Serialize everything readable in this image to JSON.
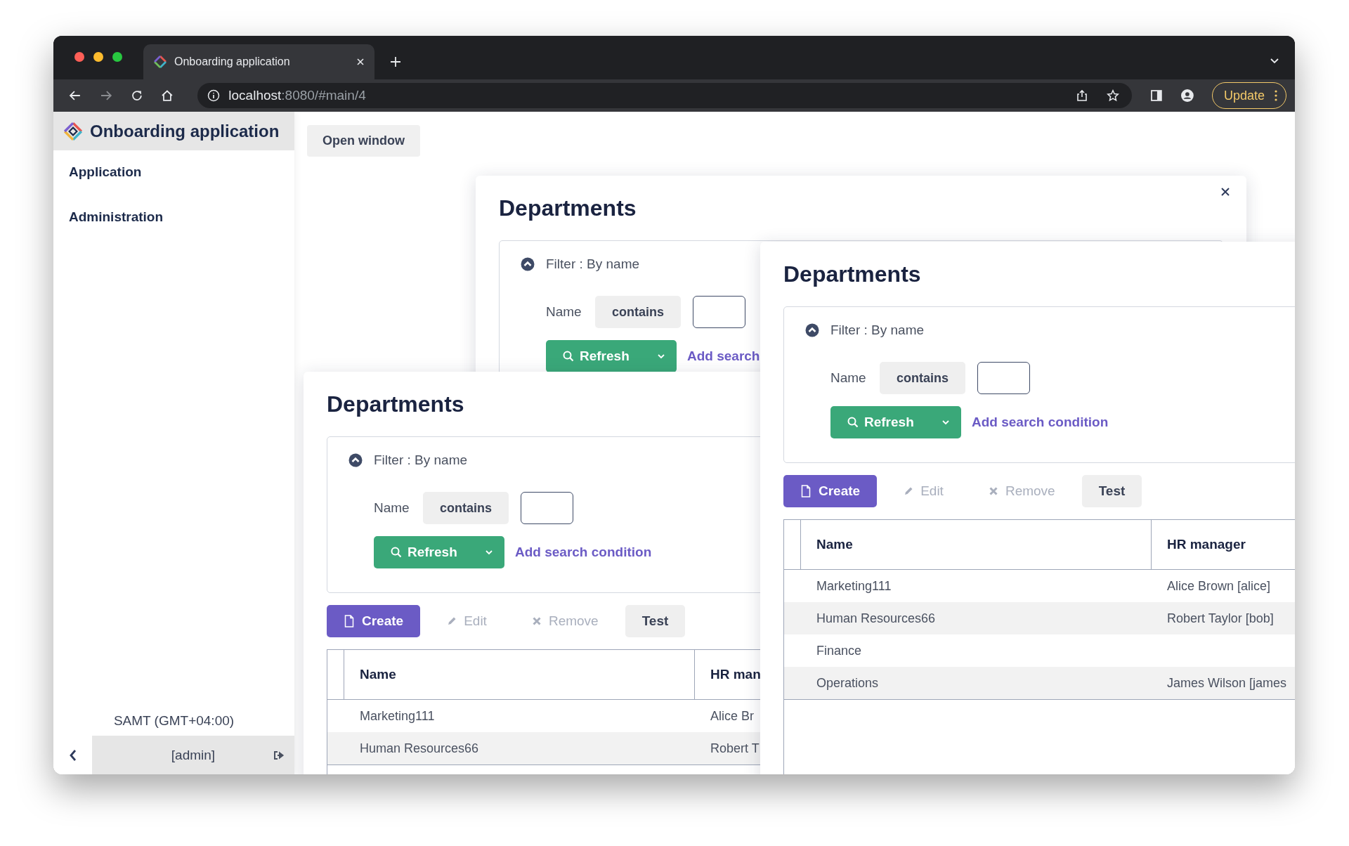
{
  "browser": {
    "tab_title": "Onboarding application",
    "url_host": "localhost",
    "url_path": ":8080/#main/4",
    "update_label": "Update"
  },
  "sidebar": {
    "title": "Onboarding application",
    "items": [
      {
        "label": "Application"
      },
      {
        "label": "Administration"
      }
    ],
    "timezone": "SAMT (GMT+04:00)",
    "user": "[admin]"
  },
  "open_window_button": "Open window",
  "dialogs": [
    {
      "title": "Departments",
      "closable": true,
      "filter": {
        "label": "Filter : By name",
        "expanded": true,
        "field": "Name",
        "operator": "contains",
        "refresh": "Refresh",
        "add_condition": "Add search"
      }
    },
    {
      "title": "Departments",
      "filter": {
        "label": "Filter : By name",
        "expanded": true,
        "field": "Name",
        "operator": "contains",
        "refresh": "Refresh",
        "add_condition": "Add search condition"
      },
      "toolbar": [
        {
          "label": "Create",
          "kind": "create",
          "disabled": false
        },
        {
          "label": "Edit",
          "kind": "edit",
          "disabled": true
        },
        {
          "label": "Remove",
          "kind": "remove",
          "disabled": true
        },
        {
          "label": "Test",
          "kind": "custom",
          "disabled": false
        }
      ],
      "table": {
        "columns": [
          "Name",
          "HR man"
        ],
        "rows": [
          {
            "cells": [
              "Marketing111",
              "Alice Br"
            ]
          },
          {
            "cells": [
              "Human Resources66",
              "Robert T"
            ]
          }
        ]
      }
    },
    {
      "title": "Departments",
      "filter": {
        "label": "Filter : By name",
        "expanded": true,
        "field": "Name",
        "operator": "contains",
        "refresh": "Refresh",
        "add_condition": "Add search condition"
      },
      "toolbar": [
        {
          "label": "Create",
          "kind": "create",
          "disabled": false
        },
        {
          "label": "Edit",
          "kind": "edit",
          "disabled": true
        },
        {
          "label": "Remove",
          "kind": "remove",
          "disabled": true
        },
        {
          "label": "Test",
          "kind": "custom",
          "disabled": false
        }
      ],
      "table": {
        "columns": [
          "Name",
          "HR manager"
        ],
        "rows": [
          {
            "cells": [
              "Marketing111",
              "Alice Brown [alice]"
            ]
          },
          {
            "cells": [
              "Human Resources66",
              "Robert Taylor [bob]"
            ]
          },
          {
            "cells": [
              "Finance"
            ]
          },
          {
            "cells": [
              "Operations",
              "James Wilson [james"
            ]
          }
        ]
      }
    }
  ]
}
